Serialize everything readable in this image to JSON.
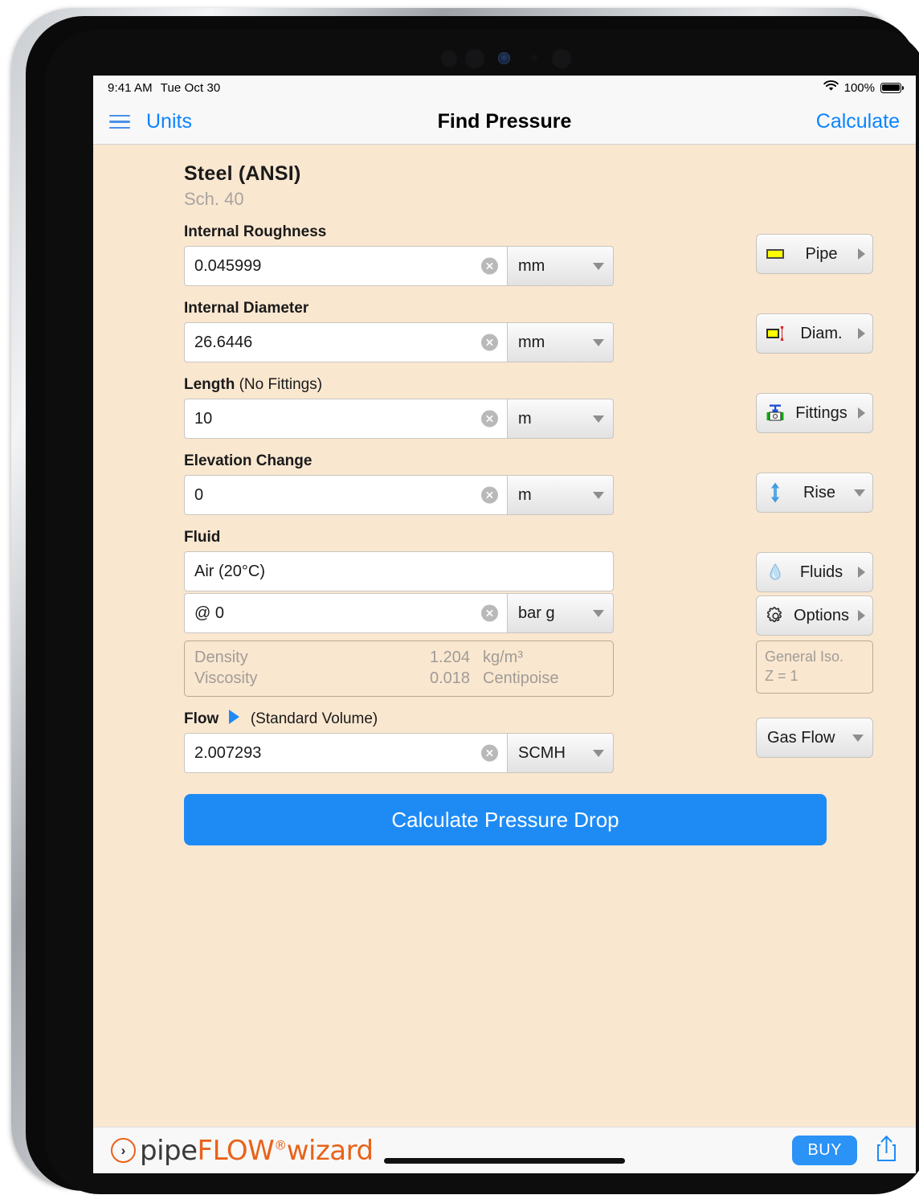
{
  "status_bar": {
    "time": "9:41 AM",
    "date": "Tue Oct 30",
    "battery_percent": "100%",
    "wifi_icon": "wifi-icon",
    "battery_icon": "battery-full-icon"
  },
  "nav": {
    "menu_icon": "hamburger-menu-icon",
    "units_label": "Units",
    "title": "Find Pressure",
    "calculate_label": "Calculate"
  },
  "material": {
    "name": "Steel (ANSI)",
    "schedule": "Sch.  40"
  },
  "fields": [
    {
      "key": "roughness",
      "label": "Internal Roughness",
      "label_suffix": "",
      "value": "0.045999",
      "unit": "mm",
      "clear_icon": "clear-circle-icon"
    },
    {
      "key": "diameter",
      "label": "Internal Diameter",
      "label_suffix": "",
      "value": "26.6446",
      "unit": "mm",
      "clear_icon": "clear-circle-icon"
    },
    {
      "key": "length",
      "label": "Length",
      "label_suffix": "(No Fittings)",
      "value": "10",
      "unit": "m",
      "clear_icon": "clear-circle-icon"
    },
    {
      "key": "elevation",
      "label": "Elevation Change",
      "label_suffix": "",
      "value": "0",
      "unit": "m",
      "clear_icon": "clear-circle-icon"
    }
  ],
  "fluid": {
    "label": "Fluid",
    "name": "Air (20°C)",
    "pressure_value": "@  0",
    "pressure_unit": "bar g",
    "clear_icon": "clear-circle-icon",
    "properties": [
      {
        "name": "Density",
        "value": "1.204",
        "unit": "kg/m³"
      },
      {
        "name": "Viscosity",
        "value": "0.018",
        "unit": "Centipoise"
      }
    ]
  },
  "flow": {
    "label": "Flow",
    "marker_icon": "flow-direction-triangle-icon",
    "note": "(Standard Volume)",
    "value": "2.007293",
    "unit": "SCMH",
    "clear_icon": "clear-circle-icon"
  },
  "side_buttons": [
    {
      "key": "pipe",
      "label": "Pipe",
      "icon": "pipe-icon",
      "chevron": "chevron-right-icon"
    },
    {
      "key": "diameter",
      "label": "Diam.",
      "icon": "diameter-icon",
      "chevron": "chevron-right-icon"
    },
    {
      "key": "fittings",
      "label": "Fittings",
      "icon": "valve-fittings-icon",
      "chevron": "chevron-right-icon"
    },
    {
      "key": "rise",
      "label": "Rise",
      "icon": "rise-arrow-icon",
      "chevron": "chevron-down-icon"
    },
    {
      "key": "fluids",
      "label": "Fluids",
      "icon": "droplet-icon",
      "chevron": "chevron-right-icon"
    },
    {
      "key": "options",
      "label": "Options",
      "icon": "gear-icon",
      "chevron": "chevron-right-icon"
    }
  ],
  "iso_box": {
    "line1": "General Iso.",
    "line2": "Z = 1"
  },
  "gas_flow_select": {
    "label": "Gas Flow",
    "chevron": "chevron-down-icon"
  },
  "cta": {
    "label": "Calculate Pressure Drop"
  },
  "toolbar": {
    "logo_mark": "chevron-circle-logo-icon",
    "logo_part1": "pipe",
    "logo_part2": "FLOW",
    "logo_reg": "®",
    "logo_part3": "wizard",
    "buy_label": "BUY",
    "share_icon": "share-up-icon"
  },
  "colors": {
    "accent_blue": "#0a84ff",
    "cta_blue": "#1e8bf5",
    "content_bg": "#fae7d0",
    "brand_orange": "#e8631a"
  }
}
